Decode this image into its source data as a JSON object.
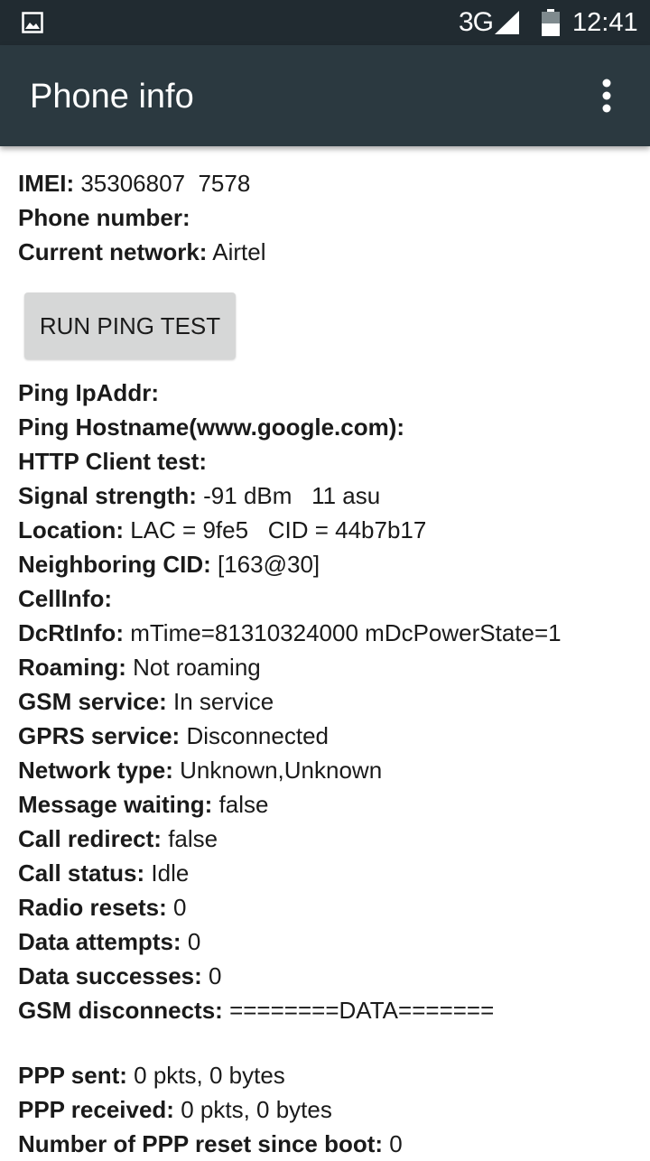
{
  "status_bar": {
    "network": "3G",
    "time": "12:41",
    "icons": [
      "image-icon",
      "signal-icon",
      "battery-icon"
    ]
  },
  "app_bar": {
    "title": "Phone info",
    "overflow_icon": "more-vert-icon"
  },
  "info_top": [
    {
      "label": "IMEI:",
      "value": "35306807  7578"
    },
    {
      "label": "Phone number:",
      "value": ""
    },
    {
      "label": "Current network:",
      "value": "Airtel"
    }
  ],
  "ping_button": "RUN PING TEST",
  "info_main": [
    {
      "label": "Ping IpAddr:",
      "value": ""
    },
    {
      "label": "Ping Hostname(www.google.com):",
      "value": ""
    },
    {
      "label": "HTTP Client test:",
      "value": ""
    },
    {
      "label": "Signal strength:",
      "value": "-91 dBm   11 asu"
    },
    {
      "label": "Location:",
      "value": "LAC = 9fe5   CID = 44b7b17"
    },
    {
      "label": "Neighboring CID:",
      "value": "[163@30]"
    },
    {
      "label": "CellInfo:",
      "value": ""
    },
    {
      "label": "DcRtInfo:",
      "value": "mTime=81310324000 mDcPowerState=1"
    },
    {
      "label": "Roaming:",
      "value": "Not roaming"
    },
    {
      "label": "GSM service:",
      "value": "In service"
    },
    {
      "label": "GPRS service:",
      "value": "Disconnected"
    },
    {
      "label": "Network type:",
      "value": "Unknown,Unknown"
    },
    {
      "label": "Message waiting:",
      "value": "false"
    },
    {
      "label": "Call redirect:",
      "value": "false"
    },
    {
      "label": "Call status:",
      "value": "Idle"
    },
    {
      "label": "Radio resets:",
      "value": "0"
    },
    {
      "label": "Data attempts:",
      "value": "0"
    },
    {
      "label": "Data successes:",
      "value": "0"
    },
    {
      "label": "GSM disconnects:",
      "value": "========DATA======="
    }
  ],
  "info_ppp": [
    {
      "label": "PPP sent:",
      "value": "0 pkts, 0 bytes"
    },
    {
      "label": "PPP received:",
      "value": "0 pkts, 0 bytes"
    },
    {
      "label": "Number of PPP reset since boot:",
      "value": "0"
    }
  ]
}
